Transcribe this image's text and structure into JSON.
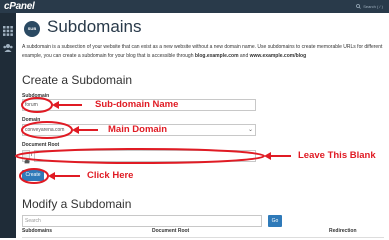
{
  "topbar": {
    "logo": "cPanel",
    "search_placeholder": "Search ( / )"
  },
  "page": {
    "title": "Subdomains",
    "logo_text": "SUB",
    "description_line1": "A subdomain is a subsection of your website that can exist as a new website without a new domain name. Use subdomains to create memorable URLs for different",
    "description_line2_prefix": "example, you can create a subdomain for your blog that is accessible through ",
    "description_link1": "blog.example.com",
    "description_and": " and ",
    "description_link2": "www.example.com/blog"
  },
  "create": {
    "heading": "Create a Subdomain",
    "subdomain_label": "Subdomain",
    "subdomain_value": "forum",
    "domain_label": "Domain",
    "domain_value": "conveyarena.com",
    "docroot_label": "Document Root",
    "docroot_prefix": "/",
    "create_button": "Create"
  },
  "annotations": {
    "subdomain": "Sub-domain Name",
    "domain": "Main Domain",
    "docroot": "Leave This Blank",
    "create": "Click Here",
    "color": "#e01b24"
  },
  "modify": {
    "heading": "Modify a Subdomain",
    "search_placeholder": "Search",
    "go_button": "Go",
    "columns": [
      "Subdomains",
      "Document Root",
      "Redirection"
    ]
  }
}
